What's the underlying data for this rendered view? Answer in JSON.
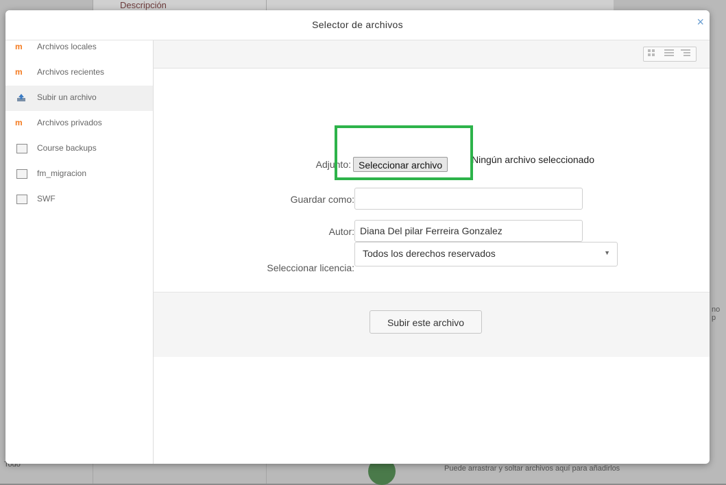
{
  "background": {
    "top_text": "Descripción",
    "bottom_text": "Puede arrastrar y soltar archivos aquí para añadirlos",
    "left_text": "Todo",
    "right_text": "no p"
  },
  "dialog": {
    "title": "Selector de archivos",
    "close_icon": "×"
  },
  "sidebar": {
    "items": [
      {
        "label": "Archivos locales",
        "icon": "moodle-icon"
      },
      {
        "label": "Archivos recientes",
        "icon": "moodle-icon"
      },
      {
        "label": "Subir un archivo",
        "icon": "upload-icon",
        "active": true
      },
      {
        "label": "Archivos privados",
        "icon": "moodle-icon"
      },
      {
        "label": "Course backups",
        "icon": "repository-icon"
      },
      {
        "label": "fm_migracion",
        "icon": "repository-icon"
      },
      {
        "label": "SWF",
        "icon": "repository-icon"
      }
    ]
  },
  "toolbar": {
    "view_icons": [
      "grid-view-icon",
      "list-view-icon",
      "tree-view-icon"
    ]
  },
  "form": {
    "attachment_label": "Adjunto:",
    "choose_file_button": "Seleccionar archivo",
    "no_file_text": "Ningún archivo seleccionado",
    "save_as_label": "Guardar como:",
    "save_as_value": "",
    "author_label": "Autor:",
    "author_value": "Diana Del pilar Ferreira Gonzalez",
    "license_label": "Seleccionar licencia:",
    "license_value": "Todos los derechos reservados"
  },
  "footer": {
    "upload_button": "Subir este archivo"
  },
  "colors": {
    "highlight": "#2db34a",
    "close_icon": "#6a9ed1",
    "moodle_orange": "#f47b20"
  }
}
